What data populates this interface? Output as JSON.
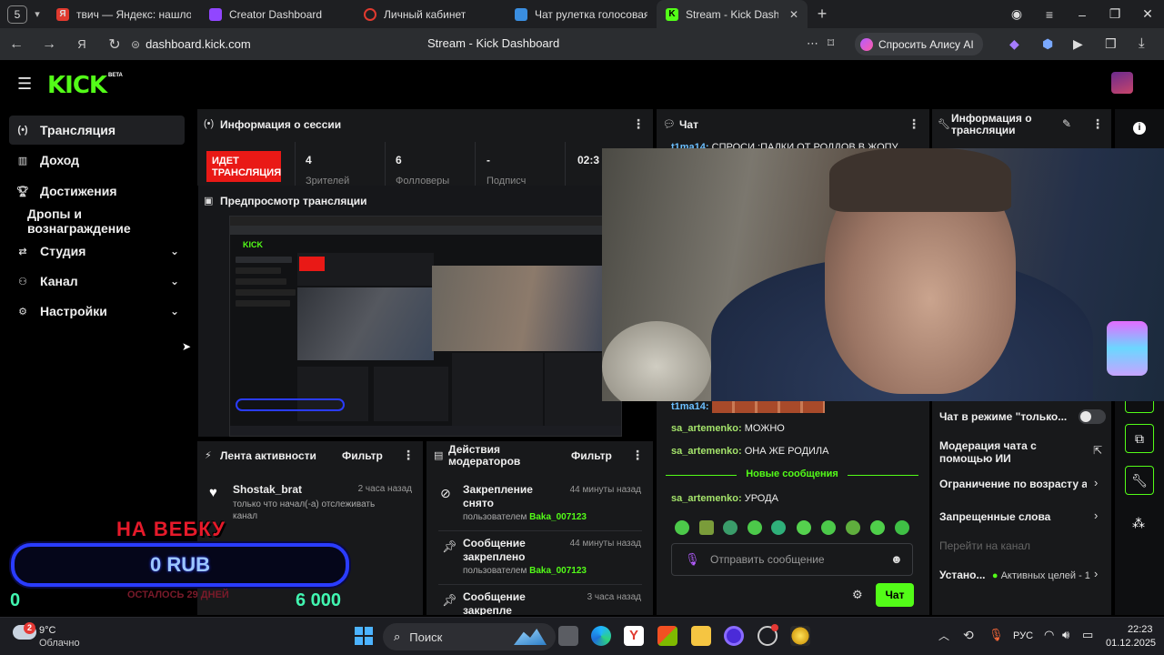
{
  "browser": {
    "tab_count": "5",
    "tabs": [
      {
        "label": "твич — Яндекс: нашлось",
        "icon": "yandex-icon",
        "color": "#e03a2f"
      },
      {
        "label": "Creator Dashboard",
        "icon": "twitch-icon",
        "color": "#9146ff"
      },
      {
        "label": "Личный кабинет",
        "icon": "ring-icon",
        "color": "#e03a2f"
      },
      {
        "label": "Чат рулетка голосовая —",
        "icon": "globe-icon",
        "color": "#3a8ee0"
      },
      {
        "label": "Stream - Kick Dashboar",
        "icon": "kick-icon",
        "color": "#53fc18"
      }
    ],
    "url": "dashboard.kick.com",
    "page_title": "Stream - Kick Dashboard",
    "alice_label": "Спросить Алису AI"
  },
  "kick": {
    "logo": "KICK",
    "beta": "BETA"
  },
  "sidebar": {
    "items": [
      {
        "label": "Трансляция",
        "icon": "broadcast-icon"
      },
      {
        "label": "Доход",
        "icon": "income-icon"
      },
      {
        "label": "Достижения",
        "icon": "trophy-icon"
      },
      {
        "label": "Дропы и вознаграждение"
      },
      {
        "label": "Студия",
        "icon": "studio-icon"
      },
      {
        "label": "Канал",
        "icon": "channel-icon"
      },
      {
        "label": "Настройки",
        "icon": "gear-icon"
      }
    ]
  },
  "session": {
    "title": "Информация о сессии",
    "live_badge": "ИДЕТ ТРАНСЛЯЦИЯ",
    "stats": [
      {
        "value": "4",
        "label": "Зрителей"
      },
      {
        "value": "6",
        "label": "Фолловеры"
      },
      {
        "value": "-",
        "label": "Подписч"
      },
      {
        "value": "02:3",
        "label": ""
      }
    ]
  },
  "preview": {
    "title": "Предпросмотр трансляции"
  },
  "chat": {
    "title": "Чат",
    "messages": [
      {
        "user": "t1ma14:",
        "text": "СПРОСИ :ПАЛКИ ОТ РОДДОВ В ЖОПУ"
      },
      {
        "user": "t1ma14:",
        "text": ""
      },
      {
        "user": "sa_artemenko:",
        "text": "МОЖНО"
      },
      {
        "user": "sa_artemenko:",
        "text": "ОНА ЖЕ РОДИЛА"
      },
      {
        "user": "sa_artemenko:",
        "text": "УРОДА"
      }
    ],
    "new_messages": "Новые сообщения",
    "input_placeholder": "Отправить сообщение",
    "send_button": "Чат"
  },
  "stream_info": {
    "title": "Информация о трансляции",
    "rows": [
      {
        "label": "Чат в режиме \"только..."
      },
      {
        "label": "Модерация чата с помощью ИИ"
      },
      {
        "label": "Ограничение по возрасту а"
      },
      {
        "label": "Запрещенные слова"
      },
      {
        "label": "Перейти на канал"
      },
      {
        "label": "Устано...",
        "badge": "Активных целей - 1"
      }
    ]
  },
  "activity": {
    "title": "Лента активности",
    "filter": "Фильтр",
    "items": [
      {
        "user": "Shostak_brat",
        "time": "2 часа назад",
        "text": "только что начал(-а) отслеживать канал"
      }
    ]
  },
  "mod_actions": {
    "title": "Действия модераторов",
    "filter": "Фильтр",
    "items": [
      {
        "action": "Закрепление снято",
        "time": "44 минуты назад",
        "by": "пользователем",
        "user": "Baka_007123"
      },
      {
        "action": "Сообщение закреплено",
        "time": "44 минуты назад",
        "by": "пользователем",
        "user": "Baka_007123"
      },
      {
        "action": "Сообщение закрепле",
        "time": "3 часа назад",
        "by": "",
        "user": ""
      }
    ]
  },
  "donation": {
    "title": "НА ВЕБКУ",
    "amount": "0 RUB",
    "min": "0",
    "max": "6 000",
    "remaining": "ОСТАЛОСЬ 29 ДНЕЙ",
    "progress": 0
  },
  "taskbar": {
    "weather_temp": "9°C",
    "weather_text": "Облачно",
    "weather_badge": "2",
    "search": "Поиск",
    "lang": "РУС",
    "time": "22:23",
    "date": "01.12.2025"
  }
}
